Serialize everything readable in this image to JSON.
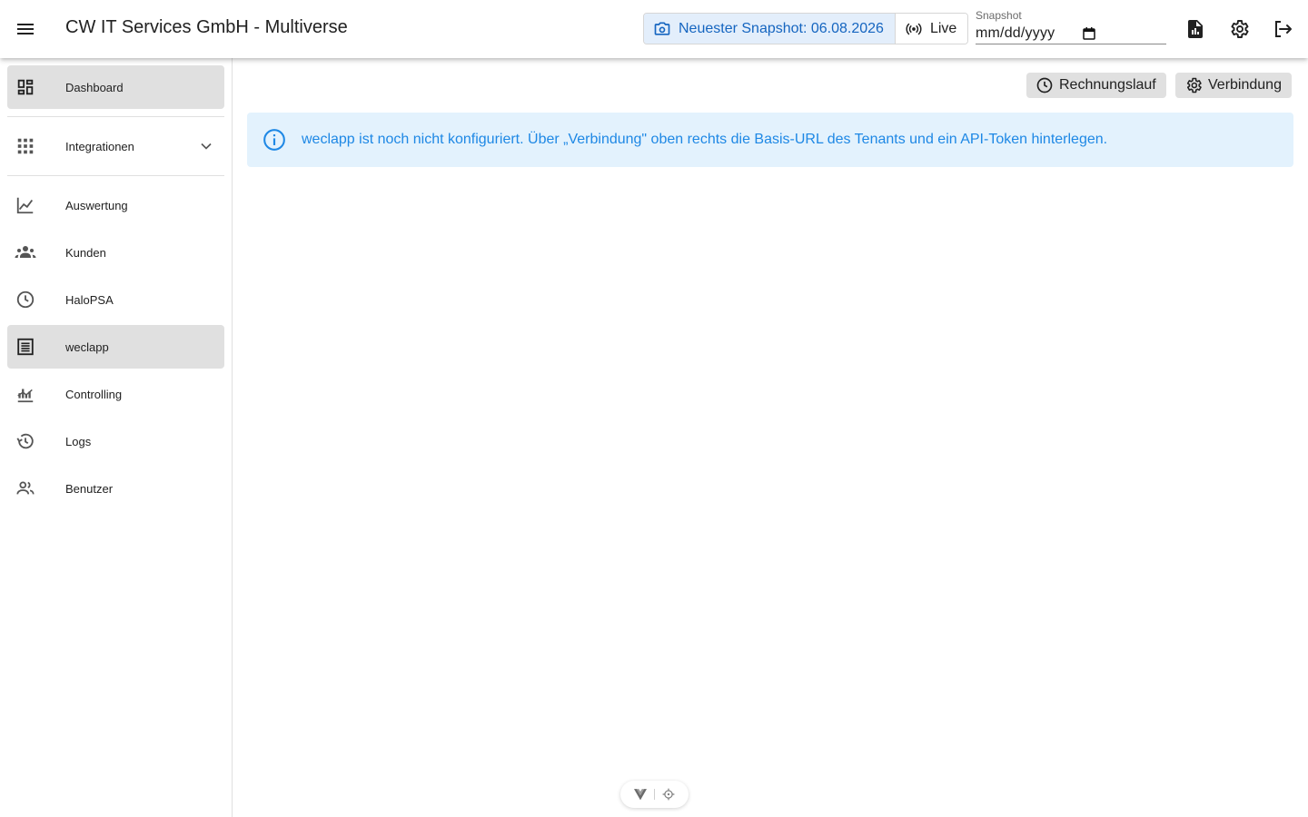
{
  "app": {
    "title": "CW IT Services GmbH - Multiverse"
  },
  "toolbar": {
    "snapshot_button": "Neuester Snapshot: 06.08.2026",
    "live_button": "Live",
    "snapshot_field_label": "Snapshot",
    "snapshot_field_placeholder": "mm/dd/yyyy"
  },
  "sidebar": {
    "items": [
      {
        "label": "Dashboard",
        "icon": "dashboard-icon"
      },
      {
        "label": "Integrationen",
        "icon": "apps-grid-icon"
      },
      {
        "label": "Auswertung",
        "icon": "line-chart-icon"
      },
      {
        "label": "Kunden",
        "icon": "groups-icon"
      },
      {
        "label": "HaloPSA",
        "icon": "clock-icon"
      },
      {
        "label": "weclapp",
        "icon": "receipt-icon"
      },
      {
        "label": "Controlling",
        "icon": "stacked-chart-icon"
      },
      {
        "label": "Logs",
        "icon": "history-icon"
      },
      {
        "label": "Benutzer",
        "icon": "people-icon"
      }
    ]
  },
  "main": {
    "actions": {
      "billing_run": "Rechnungslauf",
      "connection": "Verbindung"
    },
    "alert_text": "weclapp ist noch nicht konfiguriert. Über „Verbindung\" oben rechts die Basis-URL des Tenants und ein API-Token hinterlegen."
  },
  "colors": {
    "accent": "#1565c0",
    "info_background": "#e3f2fd",
    "info_text": "#1e88e5",
    "active_nav": "#e0e0e0"
  }
}
